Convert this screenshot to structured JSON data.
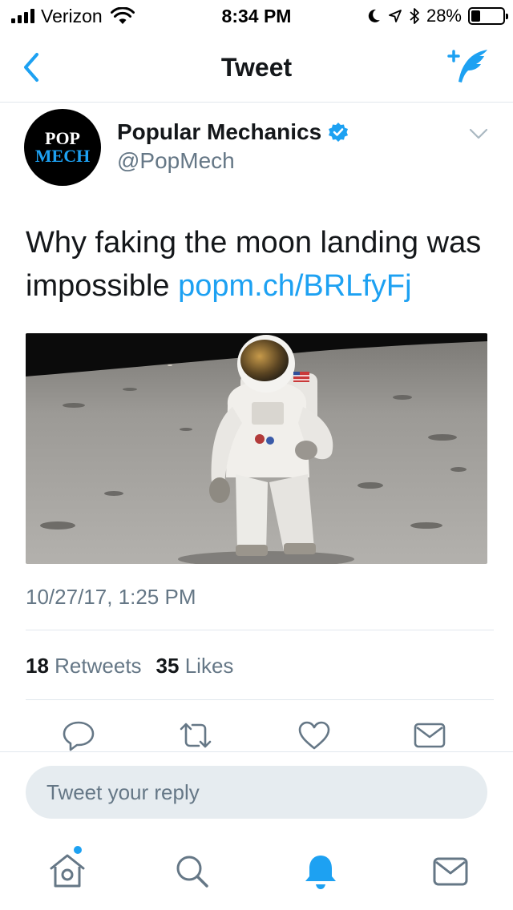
{
  "status_bar": {
    "carrier": "Verizon",
    "time": "8:34 PM",
    "battery": "28%",
    "battery_level": 0.28
  },
  "nav": {
    "title": "Tweet",
    "back_icon": "chevron-left-icon",
    "compose_icon": "compose-tweet-icon"
  },
  "tweet": {
    "avatar_line1": "POP",
    "avatar_line2": "MECH",
    "author_name": "Popular Mechanics",
    "handle": "@PopMech",
    "text": "Why faking the moon landing was impossible ",
    "link": "popm.ch/BRLfyFj",
    "timestamp": "10/27/17, 1:25 PM"
  },
  "stats": {
    "retweets_count": "18",
    "retweets_label": "Retweets",
    "likes_count": "35",
    "likes_label": "Likes"
  },
  "actions": [
    "reply-icon",
    "retweet-icon",
    "like-icon",
    "direct-message-icon"
  ],
  "reply": {
    "placeholder": "Tweet your reply"
  },
  "tab_bar": [
    "home-icon",
    "search-icon",
    "notifications-icon",
    "messages-icon"
  ],
  "colors": {
    "accent": "#1da1f2",
    "text": "#14171a",
    "secondary": "#657786",
    "divider": "#e1e8ed"
  }
}
